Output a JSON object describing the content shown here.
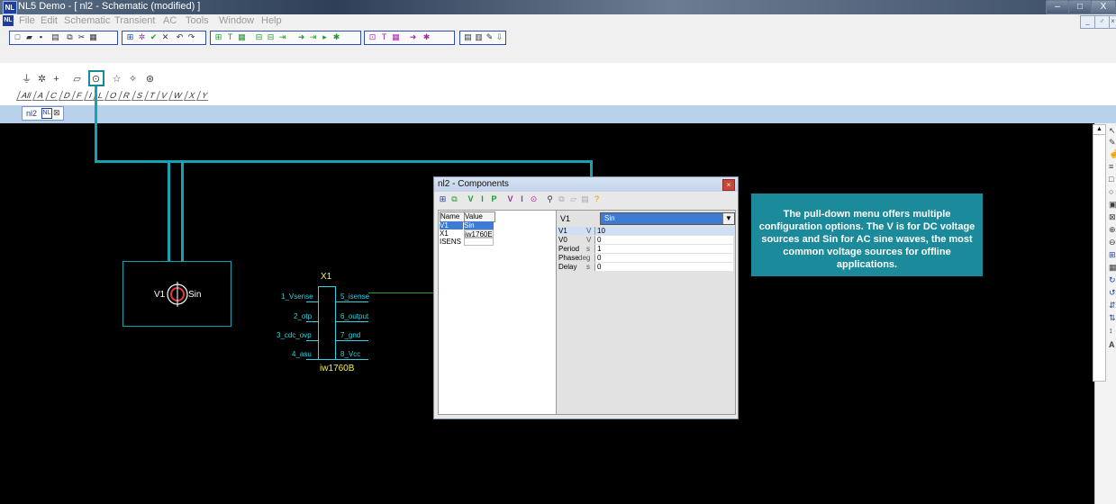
{
  "window": {
    "title": "NL5 Demo - [ nl2 - Schematic (modified) ]",
    "app_icon": "NL",
    "controls": {
      "minimize": "–",
      "maximize": "□",
      "close": "X"
    }
  },
  "menu": {
    "items": [
      "File",
      "Edit",
      "Schematic",
      "Transient",
      "AC",
      "Tools",
      "Window",
      "Help"
    ],
    "mdi_controls": [
      "_",
      "♂",
      "×"
    ]
  },
  "components_bar": {
    "letters": [
      "All",
      "A",
      "C",
      "D",
      "F",
      "I",
      "L",
      "O",
      "R",
      "S",
      "T",
      "V",
      "W",
      "X",
      "Y"
    ]
  },
  "tab": {
    "label": "nl2",
    "close": "⊠"
  },
  "schematic": {
    "v1": {
      "label": "V1",
      "type": "Sin"
    },
    "x1": {
      "ref": "X1",
      "part": "iw1760B",
      "left_pins": [
        "1_Vsense",
        "2_otp",
        "3_cdc_ovp",
        "4_asu"
      ],
      "right_pins": [
        "5_isense",
        "6_output",
        "7_gnd",
        "8_Vcc"
      ]
    }
  },
  "components_dialog": {
    "title": "nl2 - Components",
    "close": "×",
    "headers": {
      "name": "Name",
      "value": "Value"
    },
    "rows": [
      {
        "name": "V1",
        "value": "Sin"
      },
      {
        "name": "X1",
        "value": "iw1760E"
      },
      {
        "name": "ISENS",
        "value": ""
      }
    ],
    "selected_component": "V1",
    "model_value": "Sin",
    "params": [
      {
        "name": "V1",
        "unit": "V",
        "value": "10"
      },
      {
        "name": "V0",
        "unit": "V",
        "value": "0"
      },
      {
        "name": "Period",
        "unit": "s",
        "value": "1"
      },
      {
        "name": "Phase",
        "unit": "deg",
        "value": "0"
      },
      {
        "name": "Delay",
        "unit": "s",
        "value": "0"
      }
    ]
  },
  "callout": {
    "text": "The pull-down menu offers multiple configuration options. The V is for DC voltage sources and Sin for AC sine waves, the most common voltage sources for offline applications."
  },
  "colors": {
    "canvas": "#000000",
    "callout": "#1b8a9a",
    "connector": "#16a2b0",
    "pin_text": "#2fd3e0",
    "ic_label": "#f3f25a",
    "tab_strip": "#b8d2ec"
  }
}
